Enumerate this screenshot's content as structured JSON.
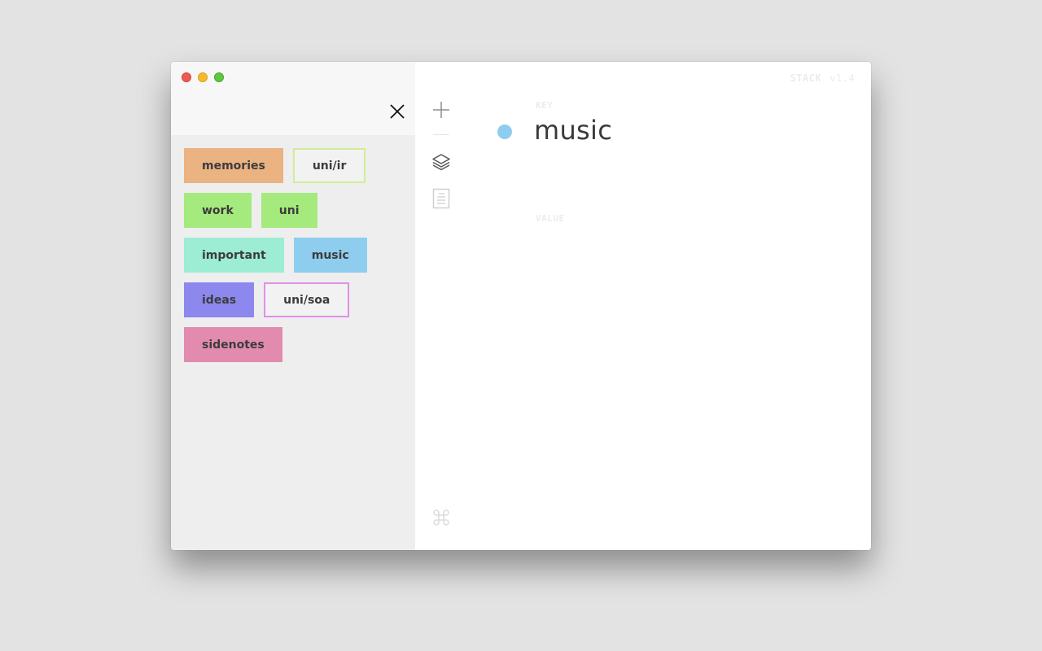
{
  "app": {
    "name": "STACK",
    "version": "v1.4"
  },
  "sidebar": {
    "tags": [
      [
        {
          "label": "memories",
          "color": "#ebb282",
          "style": "filled"
        },
        {
          "label": "uni/ir",
          "color": "#cfee96",
          "style": "outline"
        }
      ],
      [
        {
          "label": "work",
          "color": "#a4ea7c",
          "style": "filled"
        },
        {
          "label": "uni",
          "color": "#a4ea7c",
          "style": "filled"
        }
      ],
      [
        {
          "label": "important",
          "color": "#9decd4",
          "style": "filled"
        },
        {
          "label": "music",
          "color": "#8fcdee",
          "style": "filled"
        }
      ],
      [
        {
          "label": "ideas",
          "color": "#8c88ee",
          "style": "filled"
        },
        {
          "label": "uni/soa",
          "color": "#e091e6",
          "style": "outline"
        }
      ],
      [
        {
          "label": "sidenotes",
          "color": "#e28bae",
          "style": "filled"
        }
      ]
    ]
  },
  "toolbar": {
    "icons": [
      "plus-icon",
      "layers-icon",
      "document-icon",
      "command-icon"
    ]
  },
  "entry": {
    "key_label": "KEY",
    "key": "music",
    "key_color": "#8fcdee",
    "value_label": "VALUE",
    "value": ""
  }
}
